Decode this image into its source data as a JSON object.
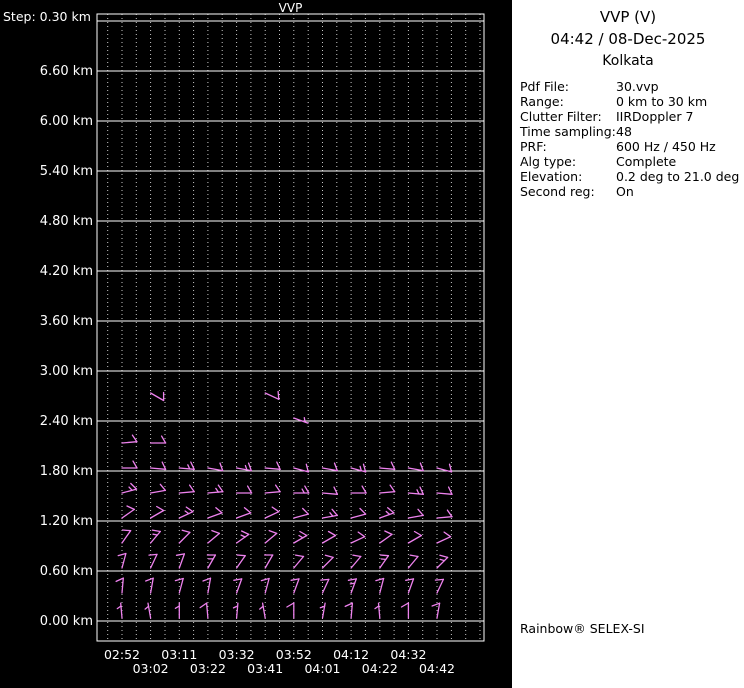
{
  "panel": {
    "title": "VVP (V)",
    "datetime": "04:42 / 08-Dec-2025",
    "site": "Kolkata",
    "fields": [
      {
        "label": "Pdf File:",
        "value": "30.vvp"
      },
      {
        "label": "Range:",
        "value": "0 km to 30 km"
      },
      {
        "label": "Clutter Filter:",
        "value": "IIRDoppler 7"
      },
      {
        "label": "Time sampling:",
        "value": "48"
      },
      {
        "label": "PRF:",
        "value": "600 Hz / 450 Hz"
      },
      {
        "label": "Alg type:",
        "value": "Complete"
      },
      {
        "label": "Elevation:",
        "value": "0.2 deg to 21.0 deg"
      },
      {
        "label": "Second reg:",
        "value": "On"
      }
    ],
    "brand": "Rainbow® SELEX-SI"
  },
  "chart_data": {
    "type": "wind-barb-profile",
    "title": "VVP",
    "step_label": "Step: 0.30 km",
    "step_km": 0.3,
    "x_tick_labels": [
      "02:52",
      "03:02",
      "03:11",
      "03:22",
      "03:32",
      "03:41",
      "03:52",
      "04:01",
      "04:12",
      "04:22",
      "04:32",
      "04:42"
    ],
    "y_tick_labels": [
      "0.00 km",
      "0.60 km",
      "1.20 km",
      "1.80 km",
      "2.40 km",
      "3.00 km",
      "3.60 km",
      "4.20 km",
      "4.80 km",
      "5.40 km",
      "6.00 km",
      "6.60 km"
    ],
    "y_tick_step_km": 0.6,
    "ylim_km": [
      -0.24,
      7.28
    ],
    "grid": {
      "horizontal_step_km": 0.6,
      "horizontal_max_km": 7.2,
      "vertical": "dotted"
    },
    "barb_color": "#ee82ee",
    "barbs": [
      {
        "t": 0,
        "h": 0.0,
        "dir": 355,
        "spd": 5
      },
      {
        "t": 0,
        "h": 0.3,
        "dir": 5,
        "spd": 10
      },
      {
        "t": 0,
        "h": 0.6,
        "dir": 15,
        "spd": 10
      },
      {
        "t": 0,
        "h": 0.9,
        "dir": 35,
        "spd": 10
      },
      {
        "t": 0,
        "h": 1.2,
        "dir": 55,
        "spd": 10
      },
      {
        "t": 0,
        "h": 1.5,
        "dir": 75,
        "spd": 15
      },
      {
        "t": 0,
        "h": 1.8,
        "dir": 90,
        "spd": 10
      },
      {
        "t": 0,
        "h": 2.1,
        "dir": 85,
        "spd": 10
      },
      {
        "t": 1,
        "h": 0.0,
        "dir": 350,
        "spd": 5
      },
      {
        "t": 1,
        "h": 0.3,
        "dir": 10,
        "spd": 10
      },
      {
        "t": 1,
        "h": 0.6,
        "dir": 25,
        "spd": 10
      },
      {
        "t": 1,
        "h": 0.9,
        "dir": 40,
        "spd": 15
      },
      {
        "t": 1,
        "h": 1.2,
        "dir": 60,
        "spd": 10
      },
      {
        "t": 1,
        "h": 1.5,
        "dir": 80,
        "spd": 10
      },
      {
        "t": 1,
        "h": 1.8,
        "dir": 95,
        "spd": 10
      },
      {
        "t": 1,
        "h": 2.1,
        "dir": 90,
        "spd": 10
      },
      {
        "t": 1,
        "h": 2.7,
        "dir": 120,
        "spd": 10
      },
      {
        "t": 2,
        "h": 0.0,
        "dir": 0,
        "spd": 5
      },
      {
        "t": 2,
        "h": 0.3,
        "dir": 15,
        "spd": 10
      },
      {
        "t": 2,
        "h": 0.6,
        "dir": 20,
        "spd": 10
      },
      {
        "t": 2,
        "h": 0.9,
        "dir": 45,
        "spd": 10
      },
      {
        "t": 2,
        "h": 1.2,
        "dir": 65,
        "spd": 15
      },
      {
        "t": 2,
        "h": 1.5,
        "dir": 85,
        "spd": 10
      },
      {
        "t": 2,
        "h": 1.8,
        "dir": 95,
        "spd": 15
      },
      {
        "t": 3,
        "h": 0.0,
        "dir": 355,
        "spd": 10
      },
      {
        "t": 3,
        "h": 0.3,
        "dir": 10,
        "spd": 10
      },
      {
        "t": 3,
        "h": 0.6,
        "dir": 30,
        "spd": 15
      },
      {
        "t": 3,
        "h": 0.9,
        "dir": 50,
        "spd": 10
      },
      {
        "t": 3,
        "h": 1.2,
        "dir": 70,
        "spd": 10
      },
      {
        "t": 3,
        "h": 1.5,
        "dir": 85,
        "spd": 15
      },
      {
        "t": 3,
        "h": 1.8,
        "dir": 100,
        "spd": 10
      },
      {
        "t": 4,
        "h": 0.0,
        "dir": 5,
        "spd": 5
      },
      {
        "t": 4,
        "h": 0.3,
        "dir": 20,
        "spd": 10
      },
      {
        "t": 4,
        "h": 0.6,
        "dir": 35,
        "spd": 10
      },
      {
        "t": 4,
        "h": 0.9,
        "dir": 55,
        "spd": 15
      },
      {
        "t": 4,
        "h": 1.2,
        "dir": 70,
        "spd": 10
      },
      {
        "t": 4,
        "h": 1.5,
        "dir": 90,
        "spd": 10
      },
      {
        "t": 4,
        "h": 1.8,
        "dir": 100,
        "spd": 15
      },
      {
        "t": 5,
        "h": 0.0,
        "dir": 350,
        "spd": 5
      },
      {
        "t": 5,
        "h": 0.3,
        "dir": 15,
        "spd": 10
      },
      {
        "t": 5,
        "h": 0.6,
        "dir": 30,
        "spd": 10
      },
      {
        "t": 5,
        "h": 0.9,
        "dir": 50,
        "spd": 10
      },
      {
        "t": 5,
        "h": 1.2,
        "dir": 65,
        "spd": 10
      },
      {
        "t": 5,
        "h": 1.5,
        "dir": 85,
        "spd": 10
      },
      {
        "t": 5,
        "h": 1.8,
        "dir": 95,
        "spd": 10
      },
      {
        "t": 5,
        "h": 2.7,
        "dir": 115,
        "spd": 10
      },
      {
        "t": 6,
        "h": 0.0,
        "dir": 0,
        "spd": 10
      },
      {
        "t": 6,
        "h": 0.3,
        "dir": 20,
        "spd": 10
      },
      {
        "t": 6,
        "h": 0.6,
        "dir": 40,
        "spd": 10
      },
      {
        "t": 6,
        "h": 0.9,
        "dir": 60,
        "spd": 15
      },
      {
        "t": 6,
        "h": 1.2,
        "dir": 75,
        "spd": 10
      },
      {
        "t": 6,
        "h": 1.5,
        "dir": 90,
        "spd": 15
      },
      {
        "t": 6,
        "h": 1.8,
        "dir": 105,
        "spd": 10
      },
      {
        "t": 6,
        "h": 2.4,
        "dir": 110,
        "spd": 5
      },
      {
        "t": 7,
        "h": 0.0,
        "dir": 10,
        "spd": 5
      },
      {
        "t": 7,
        "h": 0.3,
        "dir": 25,
        "spd": 10
      },
      {
        "t": 7,
        "h": 0.6,
        "dir": 45,
        "spd": 10
      },
      {
        "t": 7,
        "h": 0.9,
        "dir": 60,
        "spd": 10
      },
      {
        "t": 7,
        "h": 1.2,
        "dir": 80,
        "spd": 15
      },
      {
        "t": 7,
        "h": 1.5,
        "dir": 95,
        "spd": 10
      },
      {
        "t": 7,
        "h": 1.8,
        "dir": 100,
        "spd": 10
      },
      {
        "t": 8,
        "h": 0.0,
        "dir": 5,
        "spd": 10
      },
      {
        "t": 8,
        "h": 0.3,
        "dir": 20,
        "spd": 15
      },
      {
        "t": 8,
        "h": 0.6,
        "dir": 40,
        "spd": 10
      },
      {
        "t": 8,
        "h": 0.9,
        "dir": 65,
        "spd": 10
      },
      {
        "t": 8,
        "h": 1.2,
        "dir": 75,
        "spd": 10
      },
      {
        "t": 8,
        "h": 1.5,
        "dir": 90,
        "spd": 10
      },
      {
        "t": 8,
        "h": 1.8,
        "dir": 105,
        "spd": 15
      },
      {
        "t": 9,
        "h": 0.0,
        "dir": 355,
        "spd": 5
      },
      {
        "t": 9,
        "h": 0.3,
        "dir": 15,
        "spd": 10
      },
      {
        "t": 9,
        "h": 0.6,
        "dir": 35,
        "spd": 15
      },
      {
        "t": 9,
        "h": 0.9,
        "dir": 55,
        "spd": 10
      },
      {
        "t": 9,
        "h": 1.2,
        "dir": 70,
        "spd": 15
      },
      {
        "t": 9,
        "h": 1.5,
        "dir": 85,
        "spd": 10
      },
      {
        "t": 9,
        "h": 1.8,
        "dir": 95,
        "spd": 10
      },
      {
        "t": 10,
        "h": 0.0,
        "dir": 0,
        "spd": 10
      },
      {
        "t": 10,
        "h": 0.3,
        "dir": 20,
        "spd": 10
      },
      {
        "t": 10,
        "h": 0.6,
        "dir": 40,
        "spd": 10
      },
      {
        "t": 10,
        "h": 0.9,
        "dir": 60,
        "spd": 10
      },
      {
        "t": 10,
        "h": 1.2,
        "dir": 80,
        "spd": 10
      },
      {
        "t": 10,
        "h": 1.5,
        "dir": 95,
        "spd": 15
      },
      {
        "t": 10,
        "h": 1.8,
        "dir": 100,
        "spd": 10
      },
      {
        "t": 11,
        "h": 0.0,
        "dir": 10,
        "spd": 10
      },
      {
        "t": 11,
        "h": 0.3,
        "dir": 25,
        "spd": 10
      },
      {
        "t": 11,
        "h": 0.6,
        "dir": 45,
        "spd": 15
      },
      {
        "t": 11,
        "h": 0.9,
        "dir": 65,
        "spd": 10
      },
      {
        "t": 11,
        "h": 1.2,
        "dir": 85,
        "spd": 10
      },
      {
        "t": 11,
        "h": 1.5,
        "dir": 95,
        "spd": 10
      },
      {
        "t": 11,
        "h": 1.8,
        "dir": 105,
        "spd": 10
      }
    ]
  }
}
